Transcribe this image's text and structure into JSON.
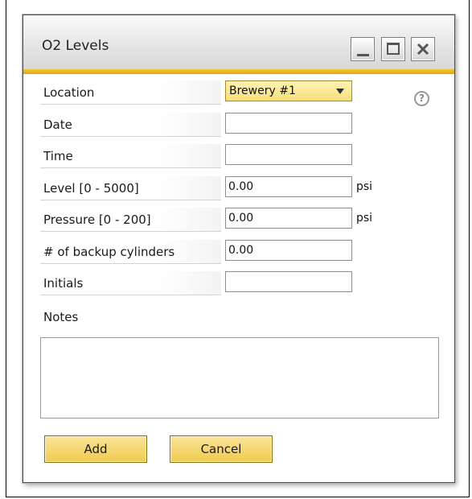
{
  "window": {
    "title": "O2 Levels"
  },
  "form": {
    "location": {
      "label": "Location",
      "value": "Brewery #1"
    },
    "date": {
      "label": "Date",
      "value": ""
    },
    "time": {
      "label": "Time",
      "value": ""
    },
    "level": {
      "label": "Level [0 - 5000]",
      "value": "0.00",
      "unit": "psi"
    },
    "pressure": {
      "label": "Pressure [0 - 200]",
      "value": "0.00",
      "unit": "psi"
    },
    "backup_cylinders": {
      "label": "# of backup cylinders",
      "value": "0.00"
    },
    "initials": {
      "label": "Initials",
      "value": ""
    },
    "notes": {
      "label": "Notes",
      "value": ""
    }
  },
  "help": {
    "glyph": "?"
  },
  "buttons": {
    "add": "Add",
    "cancel": "Cancel"
  },
  "colors": {
    "accent": "#f0b520",
    "button_fill": "#f0c94e",
    "combo_fill": "#f7df7a"
  },
  "icons": [
    "minimize-icon",
    "maximize-icon",
    "close-icon",
    "help-icon",
    "chevron-down-icon"
  ]
}
